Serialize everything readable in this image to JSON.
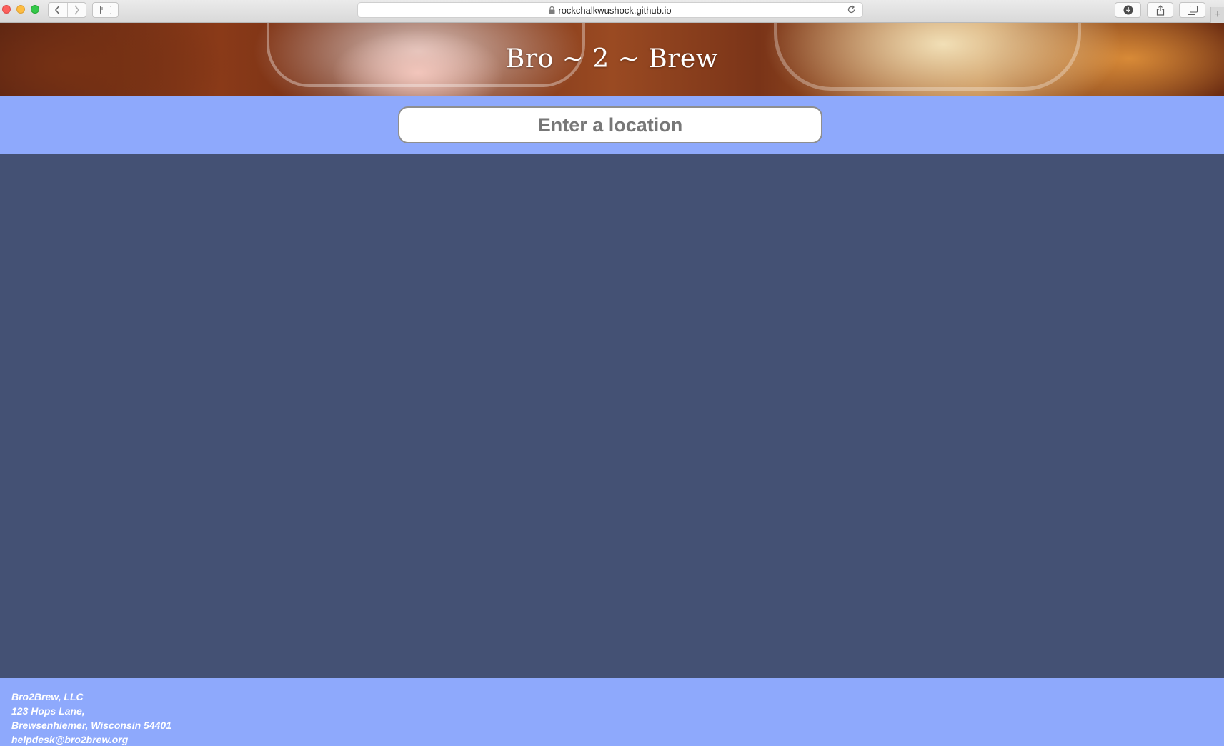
{
  "browser": {
    "url": "rockchalkwushock.github.io",
    "new_tab_label": "+"
  },
  "header": {
    "title": "Bro ~ 2 ~ Brew"
  },
  "search": {
    "placeholder": "Enter a location",
    "value": ""
  },
  "footer": {
    "company": "Bro2Brew, LLC",
    "address_line1": "123 Hops Lane,",
    "address_line2": "Brewsenhiemer, Wisconsin 54401",
    "email": "helpdesk@bro2brew.org"
  },
  "colors": {
    "band": "#8ea9fc",
    "main_background": "#445174"
  }
}
